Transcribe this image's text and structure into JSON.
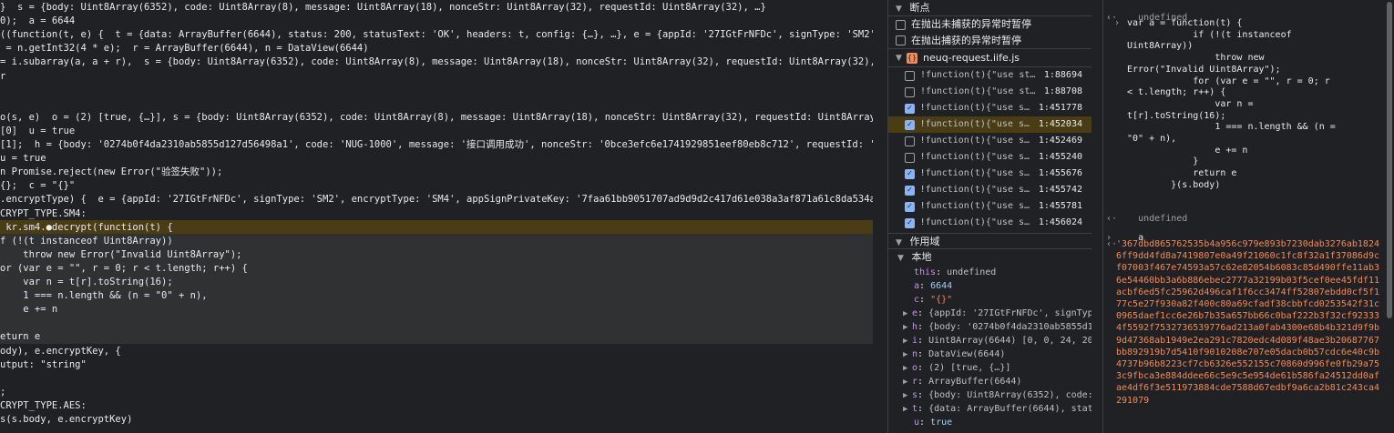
{
  "editor": {
    "lines": [
      {
        "code": "}  s = {body: Uint8Array(6352), code: Uint8Array(8), message: Uint8Array(18), nonceStr: Uint8Array(32), requestId: Uint8Array(32), …}",
        "kind": "normal"
      },
      {
        "code": "0);  a = 6644",
        "kind": "normal"
      },
      {
        "code": "((function(t, e) {  t = {data: ArrayBuffer(6644), status: 200, statusText: 'OK', headers: t, config: {…}, …}, e = {appId: '27IGtFrNFDc', signType: 'SM2', encryptT",
        "kind": "normal"
      },
      {
        "code": " = n.getInt32(4 * e);  r = ArrayBuffer(6644), n = DataView(6644)",
        "kind": "normal"
      },
      {
        "code": "= i.subarray(a, a + r),  s = {body: Uint8Array(6352), code: Uint8Array(8), message: Uint8Array(18), nonceStr: Uint8Array(32), requestId: Uint8Array(32), …}, t =",
        "kind": "normal"
      },
      {
        "code": "r",
        "kind": "normal"
      },
      {
        "code": "",
        "kind": "normal"
      },
      {
        "code": "",
        "kind": "normal"
      },
      {
        "code": "o(s, e)  o = (2) [true, {…}], s = {body: Uint8Array(6352), code: Uint8Array(8), message: Uint8Array(18), nonceStr: Uint8Array(32), requestId: Uint8Array(32), …},",
        "kind": "normal"
      },
      {
        "code": "[0]  u = true",
        "kind": "normal"
      },
      {
        "code": "[1];  h = {body: '0274b0f4da2310ab5855d127d56498a1', code: 'NUG-1000', message: '接口调用成功', nonceStr: '0bce3efc6e1741929851eef80eb8c712', requestId: '688a866a5",
        "kind": "normal"
      },
      {
        "code": "u = true",
        "kind": "normal"
      },
      {
        "code": "n Promise.reject(new Error(\"验签失败\"));",
        "kind": "normal"
      },
      {
        "code": "{};  c = \"{}\"",
        "kind": "normal"
      },
      {
        "code": ".encryptType) {  e = {appId: '27IGtFrNFDc', signType: 'SM2', encryptType: 'SM4', appSignPrivateKey: '7faa61bb9051707ad9d9d2c417d61e038a3af871a61c8da534a9061ac1e51",
        "kind": "normal"
      },
      {
        "code": "CRYPT_TYPE.SM4:",
        "kind": "normal"
      },
      {
        "code": " kr.sm4.●decrypt(function(t) {",
        "kind": "paused"
      },
      {
        "code": "f (!(t instanceof Uint8Array))",
        "kind": "block"
      },
      {
        "code": "    throw new Error(\"Invalid Uint8Array\");",
        "kind": "block"
      },
      {
        "code": "or (var e = \"\", r = 0; r < t.length; r++) {",
        "kind": "block"
      },
      {
        "code": "    var n = t[r].toString(16);",
        "kind": "block"
      },
      {
        "code": "    1 === n.length && (n = \"0\" + n),",
        "kind": "block"
      },
      {
        "code": "    e += n",
        "kind": "block"
      },
      {
        "code": "",
        "kind": "block"
      },
      {
        "code": "eturn e",
        "kind": "block"
      },
      {
        "code": "ody), e.encryptKey, {",
        "kind": "normal"
      },
      {
        "code": "utput: \"string\"",
        "kind": "normal"
      },
      {
        "code": "",
        "kind": "normal"
      },
      {
        "code": ";",
        "kind": "normal"
      },
      {
        "code": "CRYPT_TYPE.AES:",
        "kind": "normal"
      },
      {
        "code": "s(s.body, e.encryptKey)",
        "kind": "normal"
      }
    ]
  },
  "debugger": {
    "breakpoints_header": "断点",
    "pause_uncaught": "在抛出未捕获的异常时暂停",
    "pause_caught": "在抛出捕获的异常时暂停",
    "file_name": "neuq-request.iife.js",
    "breakpoints": [
      {
        "code": "!function(t){\"use st…",
        "loc": "1:88694",
        "checked": false,
        "active": false
      },
      {
        "code": "!function(t){\"use st…",
        "loc": "1:88708",
        "checked": false,
        "active": false
      },
      {
        "code": "!function(t){\"use s…",
        "loc": "1:451778",
        "checked": true,
        "active": false
      },
      {
        "code": "!function(t){\"use s…",
        "loc": "1:452034",
        "checked": true,
        "active": true
      },
      {
        "code": "!function(t){\"use s…",
        "loc": "1:452469",
        "checked": false,
        "active": false
      },
      {
        "code": "!function(t){\"use s…",
        "loc": "1:455240",
        "checked": false,
        "active": false
      },
      {
        "code": "!function(t){\"use s…",
        "loc": "1:455676",
        "checked": true,
        "active": false
      },
      {
        "code": "!function(t){\"use s…",
        "loc": "1:455742",
        "checked": true,
        "active": false
      },
      {
        "code": "!function(t){\"use s…",
        "loc": "1:455781",
        "checked": true,
        "active": false
      },
      {
        "code": "!function(t){\"use s…",
        "loc": "1:456024",
        "checked": true,
        "active": false
      }
    ],
    "scope_header": "作用域",
    "local_header": "本地",
    "scope": [
      {
        "key": "this",
        "val": "undefined",
        "kind": "obj",
        "expand": false
      },
      {
        "key": "a",
        "val": "6644",
        "kind": "num",
        "expand": false
      },
      {
        "key": "c",
        "val": "\"{}\"",
        "kind": "str",
        "expand": false
      },
      {
        "key": "e",
        "val": "{appId: '27IGtFrNFDc', signTyp",
        "kind": "obj",
        "expand": true
      },
      {
        "key": "h",
        "val": "{body: '0274b0f4da2310ab5855d1",
        "kind": "obj",
        "expand": true
      },
      {
        "key": "i",
        "val": "Uint8Array(6644) [0, 0, 24, 200",
        "kind": "obj",
        "expand": true
      },
      {
        "key": "n",
        "val": "DataView(6644)",
        "kind": "obj",
        "expand": true
      },
      {
        "key": "o",
        "val": "(2) [true, {…}]",
        "kind": "obj",
        "expand": true
      },
      {
        "key": "r",
        "val": "ArrayBuffer(6644)",
        "kind": "obj",
        "expand": true
      },
      {
        "key": "s",
        "val": "{body: Uint8Array(6352), code:",
        "kind": "obj",
        "expand": true
      },
      {
        "key": "t",
        "val": "{data: ArrayBuffer(6644), stat",
        "kind": "obj",
        "expand": true
      },
      {
        "key": "u",
        "val": "true",
        "kind": "kw",
        "expand": false
      }
    ]
  },
  "console": {
    "undefined_1": "undefined",
    "fn_lines": [
      "var a = function(t) {",
      "            if (!(t instanceof",
      "Uint8Array))",
      "                throw new",
      "Error(\"Invalid Uint8Array\");",
      "            for (var e = \"\", r = 0; r",
      "< t.length; r++) {",
      "                var n =",
      "t[r].toString(16);",
      "                1 === n.length && (n =",
      "\"0\" + n),",
      "                e += n",
      "            }",
      "            return e",
      "        }(s.body)"
    ],
    "undefined_2": "undefined",
    "input_a": "a",
    "hex_output": "'367dbd865762535b4a956c979e893b7230dab3276ab18246ff9dd4fd8a7419807e0a49f21060c1fc8f32a1f37086d9cf07003f467e74593a57c62e82054b6083c85d490ffe11ab36e54460bb3a6b886ebec2777a32199b03f5cef0ee45fdf11acbf6ed5fc25962d496caf1f6cc3474ff52807ebdd0cf5f177c5e27f930a82f400c80a69cfadf38cbbfcd0253542f31c0965daef1cc6e26b7b35a657bb66c0baf222b3f32cf923334f5592f7532736539776ad213a0fab4300e68b4b321d9f9b9d47368ab1949e2ea291c7820edc4d089f48ae3b20687767bb892919b7d5410f9010208e707e05dacb0b57cdc6e40c9b4737b96b8223cf7cb6326e552155c70860d996fe0fb29a753c9fbca3e884ddee66c5e9c5e954de61b586fa24512dd0afae4df6f3e511973884cde7588d67edbf9a6ca2b81c243ca4291079"
  }
}
